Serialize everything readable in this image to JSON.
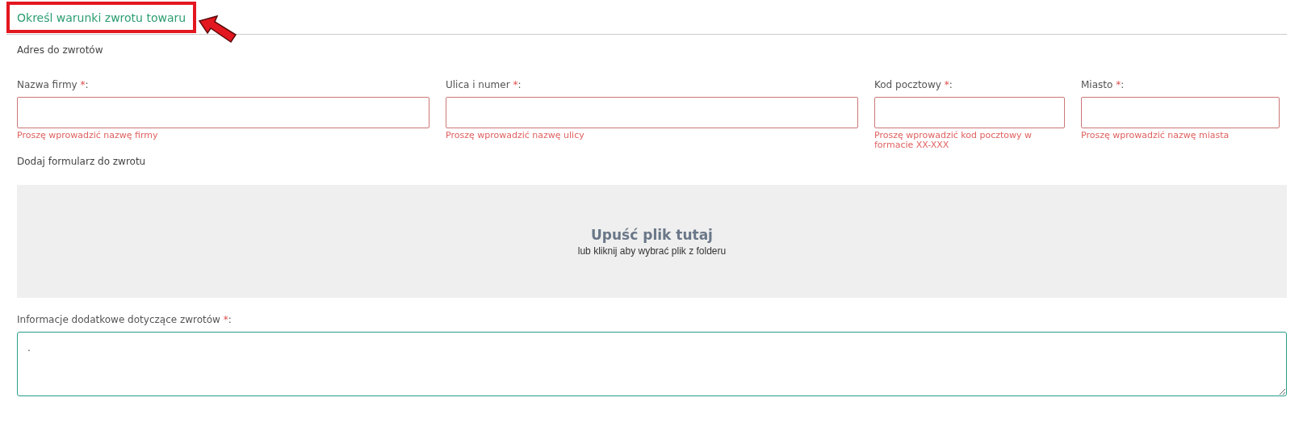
{
  "section": {
    "title": "Określ warunki zwrotu towaru",
    "highlighted": true
  },
  "address": {
    "heading": "Adres do zwrotów",
    "fields": [
      {
        "label": "Nazwa firmy",
        "mark": "*",
        "colon": ":",
        "error": "Proszę wprowadzić nazwę firmy"
      },
      {
        "label": "Ulica i numer",
        "mark": "*",
        "colon": ":",
        "error": "Proszę wprowadzić nazwę ulicy"
      },
      {
        "label": "Kod pocztowy",
        "mark": "*",
        "colon": ":",
        "error": "Proszę wprowadzić kod pocztowy w formacie XX-XXX"
      },
      {
        "label": "Miasto",
        "mark": "*",
        "colon": ":",
        "error": "Proszę wprowadzić nazwę miasta"
      }
    ]
  },
  "upload": {
    "heading": "Dodaj formularz do zwrotu",
    "title": "Upuść plik tutaj",
    "hint": "lub kliknij aby wybrać plik z folderu"
  },
  "notes": {
    "label": "Informacje dodatkowe dotyczące zwrotów",
    "mark": "*",
    "colon": ":",
    "value": "."
  }
}
